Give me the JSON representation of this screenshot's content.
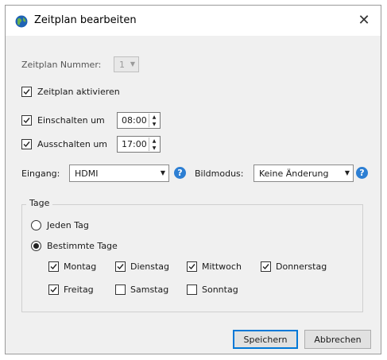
{
  "dialog": {
    "title": "Zeitplan bearbeiten",
    "close_glyph": "✕"
  },
  "schedule": {
    "number_label": "Zeitplan Nummer:",
    "number_value": "1",
    "activate_label": "Zeitplan aktivieren",
    "activate_checked": true
  },
  "power_on": {
    "label": "Einschalten um",
    "checked": true,
    "time": "08:00"
  },
  "power_off": {
    "label": "Ausschalten um",
    "checked": true,
    "time": "17:00"
  },
  "input": {
    "label": "Eingang:",
    "value": "HDMI",
    "help": "?"
  },
  "picture_mode": {
    "label": "Bildmodus:",
    "value": "Keine Änderung",
    "help": "?"
  },
  "days": {
    "group_label": "Tage",
    "every_day_label": "Jeden Tag",
    "specific_days_label": "Bestimmte Tage",
    "selected_option": "specific",
    "items": [
      {
        "label": "Montag",
        "checked": true
      },
      {
        "label": "Dienstag",
        "checked": true
      },
      {
        "label": "Mittwoch",
        "checked": true
      },
      {
        "label": "Donnerstag",
        "checked": true
      },
      {
        "label": "Freitag",
        "checked": true
      },
      {
        "label": "Samstag",
        "checked": false
      },
      {
        "label": "Sonntag",
        "checked": false
      }
    ]
  },
  "buttons": {
    "save": "Speichern",
    "cancel": "Abbrechen"
  },
  "colors": {
    "accent": "#0078d7",
    "help_icon": "#2d7fd3"
  }
}
